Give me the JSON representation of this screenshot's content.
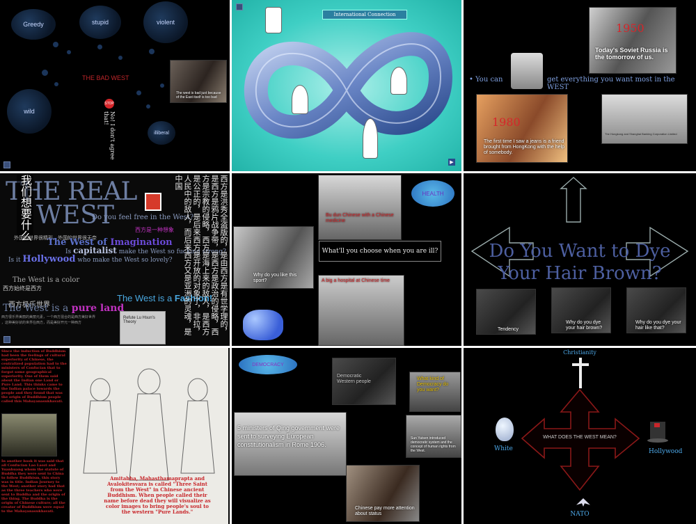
{
  "p1": {
    "clouds": [
      "Greedy",
      "stupid",
      "violent",
      "wild",
      "illiberal"
    ],
    "title": "THE BAD WEST",
    "stop": "STOP",
    "vertical": "No! I don't agree that!",
    "video_caption": "The west is bad just because of the East itself is too bad"
  },
  "p2": {
    "title": "International Connection"
  },
  "p3": {
    "year1": "1950",
    "news": "Today's Soviet Russia is the tomorrow of us.",
    "bullet_a": "You can",
    "bullet_b": "get everything you want most in the WEST",
    "year2": "1980",
    "video_caption": "The first time I saw a jeans is a friend brought from HongKong with the help of somebody.",
    "newspaper": "The Hongkong and Shanghai Banking Corporation Limited"
  },
  "p4": {
    "cn_vertical": "我们想要什么",
    "title1": "THE REAL",
    "title2": "WEST",
    "l1": "Do you feel free in the West?",
    "l1cn": "西方是一种想象",
    "l2": "外国的世界很精彩，外国的世界很无奈",
    "l3a": "The West of",
    "l3b": "Imagination",
    "l4a": "Is",
    "l4b": "capitalist",
    "l4c": "make the West so fucking strong?",
    "l5a": "Is it",
    "l5b": "Hollywood",
    "l5c": "who make the West so lovely?",
    "l6": "The West is a color",
    "l6cn": "西方始终是西方",
    "l7cn": "西方极乐世界",
    "l8a": "The West is a",
    "l8b": "pure land",
    "l9a": "The West is a",
    "l9b": "Fashion!",
    "l10": "西方很乐界美丽的美丽元素，一个西方混合的是西方美好世界",
    "l11": "，这种美好状的世界在西方，而是美好开元一种西方",
    "book": "Refute Lu Hsun's Theory",
    "small_book": "Lu Hsun",
    "cn_columns": "西方是洪秀全盗版的，是由西方是有世学理的，是西方是鸦片战争带，是西方是政治的侵略，西方是宗教的侵略，西方是海上来的敌人，是西方是公正的，是后来西方是开放的对象了，非拉，人民中的敌人，而后来西方又是亚洲的灵魂，是中国"
  },
  "p5": {
    "bubble": "HEALTH",
    "photo1_caption": "Bu dun Chinese with a Chinese medicine",
    "question": "What'll you choose when you are ill?",
    "video_caption": "Why do you like this sport?",
    "photo2_caption": "A big a hospital at Chinese time"
  },
  "p6": {
    "line1": "Do You Want to Dye",
    "line2": "Your Hair Brown?",
    "cap1": "Tendency",
    "cap2": "Why do you dye your hair brown?",
    "cap3": "Why do you dye your hair like that?"
  },
  "p7": {
    "left_text_top": "Since the induction of Buddhism had been the feelings of cultural superiority of Chinese, the centralized population had to the ministers of Confucian that to forgot some geographical superiority. One of them said about the Indian one Land or Pure Land. This thinks came to the Indian palace towards the people and they found that was the origin of Buddhism people called this Mahayanasukhavati.",
    "left_text_bottom": "In another book it was said that all Confucian Lao Laozi and Yuanhuang whom the statute of Buddha they were sent to China to follow Buddhism, this story was in title. Indian Journey to the West; another story had that as the three teachers who were sent to Buddha and the origin of the thing. The Buddha is the origin of Chinese culture; all the creator of Buddhism were equal to the Mahayanasukhavati.",
    "caption": "Amitabha, Mahasthamaprapta and Avalokitesvara is called \"Three Saint from the West\" in Chinese ancient Buddhism. When people called their name before dead they will visualize as color images to bring people's soul to the western \"Pure Lands.\""
  },
  "p8": {
    "bubble": "DEMOCRACY",
    "video1_caption": "Democratic Western people",
    "q": "What kind of Democracy do you want?",
    "main": "5 ministers of Qing government were sent to surveying European constitutionalism in Rome 1906.",
    "photo_caption": "Sun Yatsen introduced democratic system and the concept of human rights from the West.",
    "video2_caption": "Chinese pay more attention about status"
  },
  "p9": {
    "top": "Christianity",
    "center": "WHAT DOES THE WEST MEAN?",
    "left": "White",
    "right": "Hollywood",
    "bottom": "NATO"
  }
}
